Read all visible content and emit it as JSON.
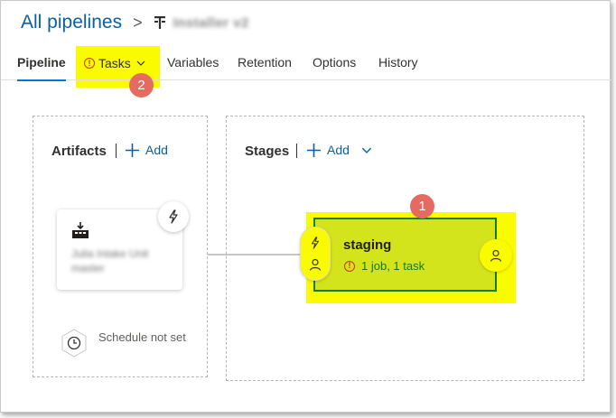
{
  "header": {
    "breadcrumb_root": "All pipelines",
    "separator": ">",
    "pipeline_name": "Installer v2"
  },
  "tabs": [
    {
      "label": "Pipeline",
      "active": true
    },
    {
      "label": "Tasks",
      "active": false,
      "warning": true
    },
    {
      "label": "Variables",
      "active": false
    },
    {
      "label": "Retention",
      "active": false
    },
    {
      "label": "Options",
      "active": false
    },
    {
      "label": "History",
      "active": false
    }
  ],
  "callouts": [
    "1",
    "2"
  ],
  "artifacts": {
    "title": "Artifacts",
    "add_label": "Add",
    "artifact_line1": "Julia Intake Unit",
    "artifact_line2": "master",
    "schedule_text": "Schedule not set"
  },
  "stages": {
    "title": "Stages",
    "add_label": "Add",
    "stage_name": "staging",
    "stage_status": "1 job, 1 task"
  },
  "colors": {
    "link_blue": "#0b5fa5",
    "tab_underline": "#0078d4",
    "highlight_yellow": "#fbfb00",
    "stage_fill": "#d4e41c",
    "stage_border": "#107c10",
    "warning": "#c43c00",
    "callout": "#e46a62"
  },
  "icons": {
    "pipeline": "pipeline-icon",
    "warning": "warning-circle-icon",
    "add": "plus-icon",
    "artifact": "build-artifact-icon",
    "trigger": "lightning-icon",
    "schedule": "clock-icon",
    "approver": "person-icon"
  }
}
